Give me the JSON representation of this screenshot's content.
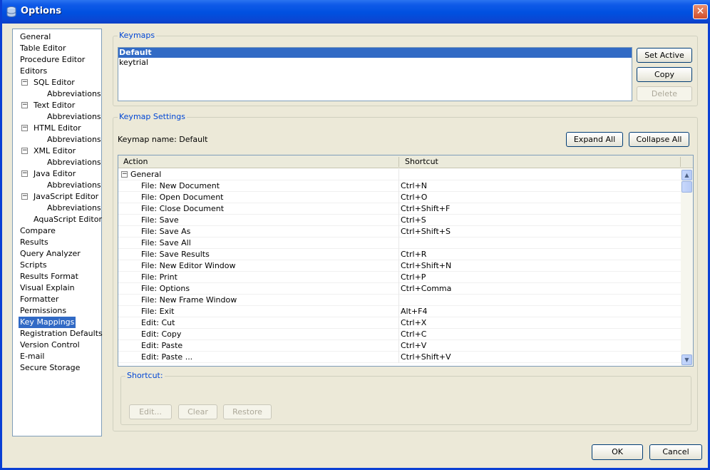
{
  "window": {
    "title": "Options",
    "close_label": "✕"
  },
  "tree": {
    "items": [
      {
        "label": "General"
      },
      {
        "label": "Table Editor"
      },
      {
        "label": "Procedure Editor"
      },
      {
        "label": "Editors"
      },
      {
        "label": "SQL Editor"
      },
      {
        "label": "Abbreviations"
      },
      {
        "label": "Text Editor"
      },
      {
        "label": "Abbreviations"
      },
      {
        "label": "HTML Editor"
      },
      {
        "label": "Abbreviations"
      },
      {
        "label": "XML Editor"
      },
      {
        "label": "Abbreviations"
      },
      {
        "label": "Java Editor"
      },
      {
        "label": "Abbreviations"
      },
      {
        "label": "JavaScript Editor"
      },
      {
        "label": "Abbreviations"
      },
      {
        "label": "AquaScript Editor"
      },
      {
        "label": "Compare"
      },
      {
        "label": "Results"
      },
      {
        "label": "Query Analyzer"
      },
      {
        "label": "Scripts"
      },
      {
        "label": "Results Format"
      },
      {
        "label": "Visual Explain"
      },
      {
        "label": "Formatter"
      },
      {
        "label": "Permissions"
      },
      {
        "label": "Key Mappings"
      },
      {
        "label": "Registration Defaults"
      },
      {
        "label": "Version Control"
      },
      {
        "label": "E-mail"
      },
      {
        "label": "Secure Storage"
      }
    ],
    "selected": "Key Mappings"
  },
  "keymaps": {
    "group_label": "Keymaps",
    "list": [
      "Default",
      "keytrial"
    ],
    "set_active_label": "Set Active",
    "copy_label": "Copy",
    "delete_label": "Delete"
  },
  "settings": {
    "group_label": "Keymap Settings",
    "keymap_name": "Keymap name: Default",
    "expand_all_label": "Expand All",
    "collapse_all_label": "Collapse All",
    "columns": {
      "action": "Action",
      "shortcut": "Shortcut"
    },
    "group_row": "General",
    "rows": [
      {
        "action": "File: New Document",
        "shortcut": "Ctrl+N"
      },
      {
        "action": "File: Open Document",
        "shortcut": "Ctrl+O"
      },
      {
        "action": "File: Close Document",
        "shortcut": "Ctrl+Shift+F"
      },
      {
        "action": "File: Save",
        "shortcut": "Ctrl+S"
      },
      {
        "action": "File: Save As",
        "shortcut": "Ctrl+Shift+S"
      },
      {
        "action": "File: Save All",
        "shortcut": ""
      },
      {
        "action": "File: Save Results",
        "shortcut": "Ctrl+R"
      },
      {
        "action": "File: New Editor Window",
        "shortcut": "Ctrl+Shift+N"
      },
      {
        "action": "File: Print",
        "shortcut": "Ctrl+P"
      },
      {
        "action": "File: Options",
        "shortcut": "Ctrl+Comma"
      },
      {
        "action": "File: New Frame Window",
        "shortcut": ""
      },
      {
        "action": "File: Exit",
        "shortcut": "Alt+F4"
      },
      {
        "action": "Edit: Cut",
        "shortcut": "Ctrl+X"
      },
      {
        "action": "Edit: Copy",
        "shortcut": "Ctrl+C"
      },
      {
        "action": "Edit: Paste",
        "shortcut": "Ctrl+V"
      },
      {
        "action": "Edit: Paste ...",
        "shortcut": "Ctrl+Shift+V"
      }
    ]
  },
  "shortcut": {
    "group_label": "Shortcut:",
    "edit_label": "Edit...",
    "clear_label": "Clear",
    "restore_label": "Restore"
  },
  "footer": {
    "ok_label": "OK",
    "cancel_label": "Cancel"
  },
  "colors": {
    "accent": "#316ac5",
    "title_bar": "#0050e0",
    "group_label": "#0046d5"
  }
}
